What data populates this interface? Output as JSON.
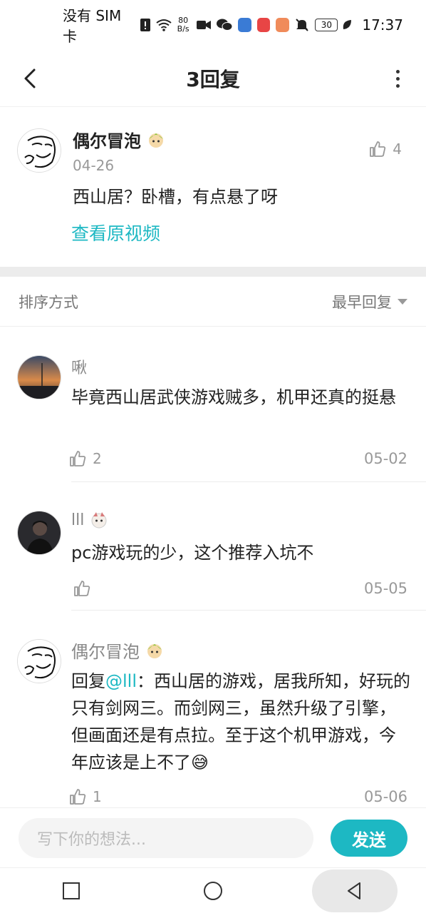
{
  "status_bar": {
    "sim_text": "没有 SIM 卡",
    "net_speed_value": "80",
    "net_speed_unit": "B/s",
    "battery": "30",
    "time": "17:37"
  },
  "header": {
    "title": "3回复"
  },
  "main_comment": {
    "author": "偶尔冒泡",
    "date": "04-26",
    "text": "西山居？卧槽，有点悬了呀",
    "view_video_link": "查看原视频",
    "likes": "4"
  },
  "sort": {
    "label": "排序方式",
    "option": "最早回复"
  },
  "replies": [
    {
      "author": "啾",
      "text": "毕竟西山居武侠游戏贼多，机甲还真的挺悬",
      "likes": "2",
      "date": "05-02"
    },
    {
      "author": "lll",
      "text": "pc游戏玩的少，这个推荐入坑不",
      "likes": "",
      "date": "05-05"
    },
    {
      "author": "偶尔冒泡",
      "reply_prefix": "回复",
      "mention": "@lll",
      "text": "：西山居的游戏，居我所知，好玩的只有剑网三。而剑网三，虽然升级了引擎，但画面还是有点拉。至于这个机甲游戏，今年应该是上不了😅",
      "likes": "1",
      "date": "05-06"
    }
  ],
  "input": {
    "placeholder": "写下你的想法...",
    "send_label": "发送"
  },
  "colors": {
    "accent": "#1db8c3",
    "divider": "#ececec"
  }
}
